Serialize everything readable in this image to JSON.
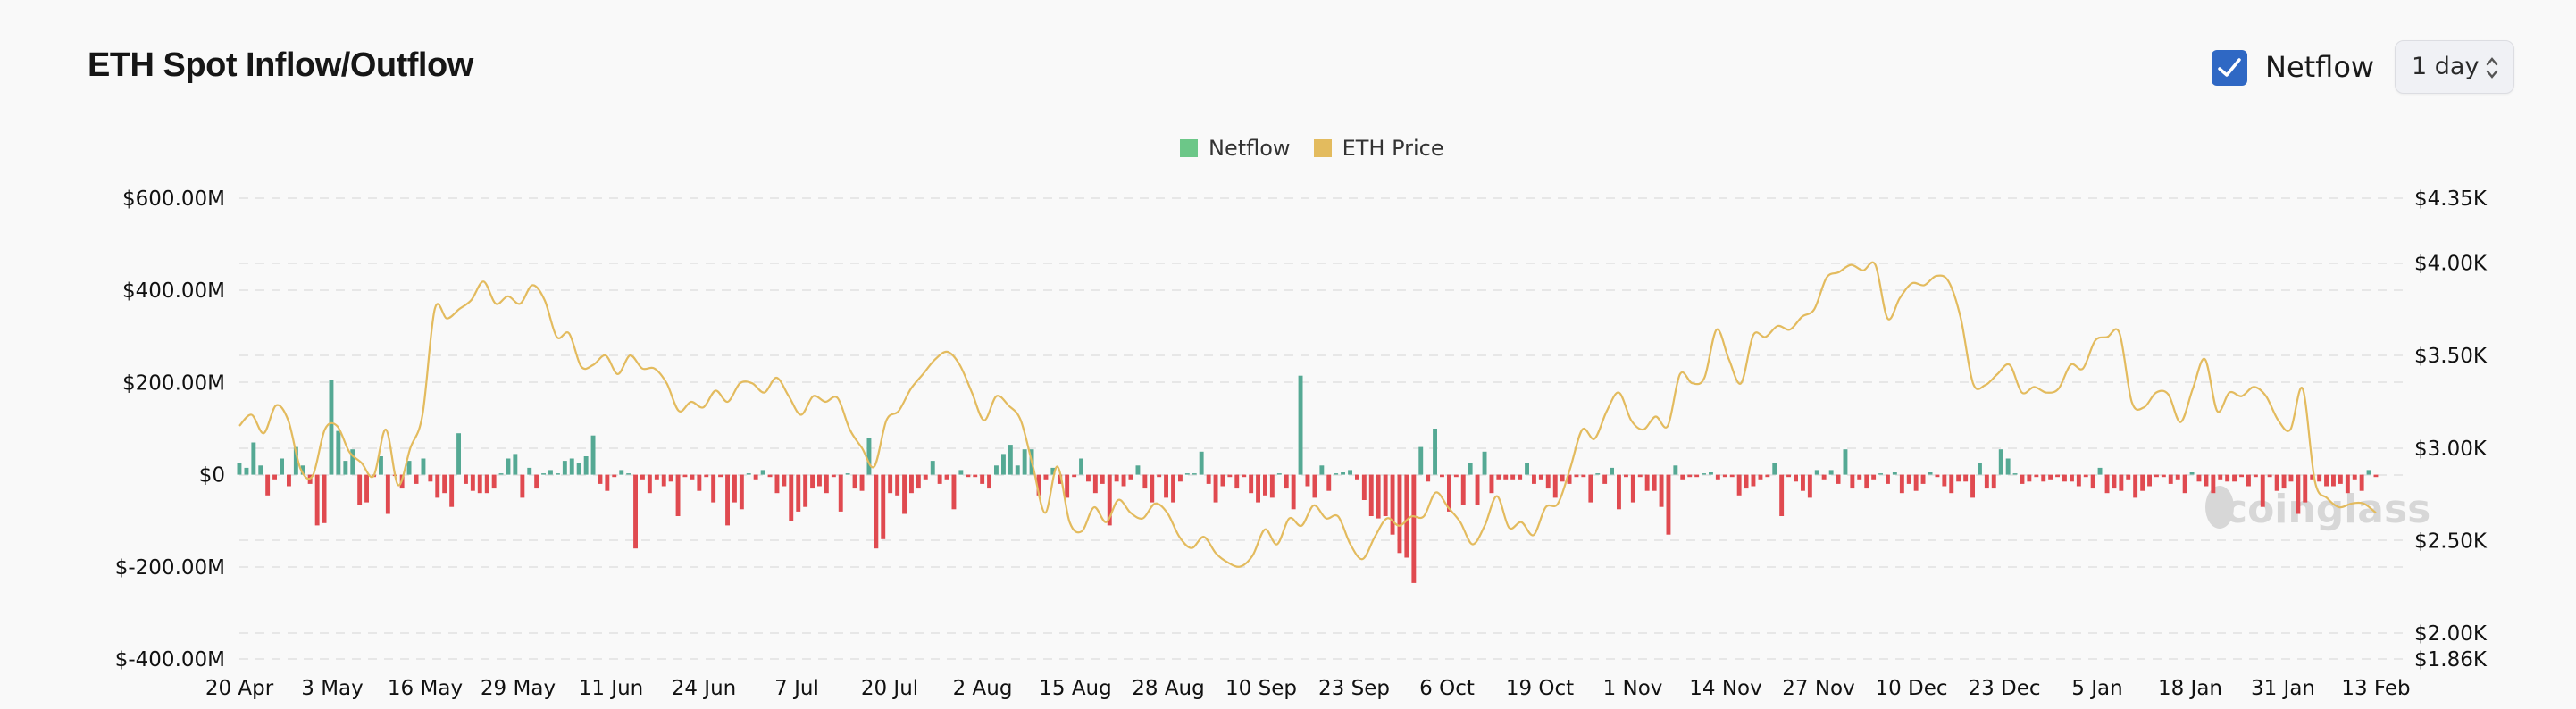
{
  "header": {
    "title": "ETH Spot Inflow/Outflow",
    "netflow_checkbox": {
      "label": "Netflow",
      "checked": true
    },
    "interval_select": {
      "value": "1 day"
    }
  },
  "legend": [
    {
      "label": "Netflow",
      "color": "#6cc788"
    },
    {
      "label": "ETH Price",
      "color": "#e3bb5e"
    }
  ],
  "watermark": "coinglass",
  "chart_data": {
    "type": "bar",
    "title": "ETH Spot Inflow/Outflow",
    "xlabel": "",
    "ylabel": "Netflow",
    "y2label": "ETH Price",
    "grid": true,
    "legend_position": "top-center",
    "x_tick_labels": [
      "20 Apr",
      "3 May",
      "16 May",
      "29 May",
      "11 Jun",
      "24 Jun",
      "7 Jul",
      "20 Jul",
      "2 Aug",
      "15 Aug",
      "28 Aug",
      "10 Sep",
      "23 Sep",
      "6 Oct",
      "19 Oct",
      "1 Nov",
      "14 Nov",
      "27 Nov",
      "10 Dec",
      "23 Dec",
      "5 Jan",
      "18 Jan",
      "31 Jan",
      "13 Feb"
    ],
    "y_left": {
      "ticks": [
        "$600.00M",
        "$400.00M",
        "$200.00M",
        "$0",
        "$-200.00M",
        "$-400.00M"
      ],
      "tick_values": [
        600,
        400,
        200,
        0,
        -200,
        -400
      ],
      "range": [
        -400,
        600
      ],
      "unit": "USD millions"
    },
    "y_right": {
      "ticks": [
        "$4.35K",
        "$4.00K",
        "$3.50K",
        "$3.00K",
        "$2.50K",
        "$2.00K",
        "$1.86K"
      ],
      "tick_values": [
        4350,
        4000,
        3500,
        3000,
        2500,
        2000,
        1860
      ],
      "range": [
        1860,
        4350
      ],
      "unit": "USD"
    },
    "positive_color": "#55a994",
    "negative_color": "#e04a50",
    "price_color": "#e3bb5e",
    "series": [
      {
        "name": "Netflow",
        "type": "bar",
        "start_date": "20 Apr",
        "interval": "1 day",
        "values": [
          25,
          15,
          70,
          20,
          -45,
          -10,
          35,
          -25,
          60,
          20,
          -20,
          -110,
          -105,
          205,
          95,
          30,
          55,
          -65,
          -60,
          -5,
          40,
          -85,
          -3,
          -30,
          30,
          -20,
          35,
          -15,
          -50,
          -40,
          -70,
          90,
          -20,
          -35,
          -40,
          -40,
          -30,
          0,
          35,
          45,
          -50,
          15,
          -30,
          0,
          10,
          0,
          30,
          35,
          25,
          40,
          85,
          -20,
          -35,
          -5,
          10,
          0,
          -160,
          -10,
          -40,
          -10,
          -25,
          -15,
          -90,
          -5,
          -10,
          -35,
          -5,
          -60,
          -5,
          -110,
          -60,
          -75,
          0,
          -10,
          10,
          -5,
          -40,
          -25,
          -100,
          -80,
          -70,
          -30,
          -25,
          -40,
          -5,
          -80,
          0,
          -30,
          -35,
          80,
          -160,
          -140,
          -40,
          -45,
          -85,
          -40,
          -30,
          -10,
          30,
          -20,
          -10,
          -75,
          10,
          -5,
          -5,
          -20,
          -30,
          20,
          45,
          65,
          20,
          55,
          55,
          -45,
          -10,
          15,
          -20,
          -50,
          -5,
          35,
          -15,
          -40,
          -20,
          -110,
          -15,
          -25,
          -10,
          20,
          -30,
          -60,
          -5,
          -50,
          -60,
          -15,
          0,
          0,
          50,
          -20,
          -60,
          -25,
          -5,
          -30,
          -5,
          -40,
          -60,
          -45,
          -50,
          0,
          -30,
          -75,
          215,
          -25,
          -50,
          20,
          -35,
          0,
          5,
          10,
          -10,
          -55,
          -90,
          -95,
          -90,
          -130,
          -170,
          -180,
          -235,
          60,
          -15,
          100,
          -5,
          -80,
          -5,
          -65,
          25,
          -65,
          50,
          -40,
          -10,
          -10,
          -10,
          -10,
          25,
          -20,
          -10,
          -30,
          -50,
          -15,
          -20,
          -5,
          -5,
          -60,
          0,
          -20,
          15,
          -75,
          -5,
          -60,
          -5,
          -35,
          -35,
          -70,
          -130,
          20,
          -10,
          -5,
          -5,
          0,
          5,
          -10,
          -5,
          -5,
          -45,
          -30,
          -25,
          -10,
          -5,
          25,
          -90,
          -5,
          -15,
          -35,
          -50,
          10,
          -10,
          10,
          -20,
          55,
          -30,
          -10,
          -30,
          -10,
          0,
          -20,
          5,
          -40,
          -20,
          -35,
          -20,
          5,
          -5,
          -25,
          -40,
          -15,
          -15,
          -50,
          25,
          -30,
          -30,
          55,
          35,
          0,
          -20,
          -15,
          -5,
          -15,
          -10,
          -5,
          -15,
          -15,
          -25,
          -5,
          -30,
          15,
          -40,
          -30,
          -35,
          -10,
          -50,
          -35,
          -25,
          -5,
          -5,
          -20,
          -10,
          -40,
          5,
          -15,
          -25,
          -40,
          -10,
          -15,
          -15,
          -5,
          -25,
          -5,
          -70,
          -5,
          -35,
          -30,
          -15,
          -85,
          -60,
          -10,
          -15,
          -25,
          -25,
          -20,
          -40,
          -10,
          -35,
          10,
          -5
        ],
        "note": "Bars per day (USD millions), read approximately from the chart"
      },
      {
        "name": "ETH Price",
        "type": "line",
        "sample_every_days": 4,
        "values": [
          3120,
          3180,
          3080,
          3230,
          3150,
          2890,
          2850,
          3100,
          3120,
          2980,
          2920,
          2850,
          3100,
          2800,
          3000,
          3180,
          3750,
          3700,
          3750,
          3800,
          3900,
          3780,
          3820,
          3780,
          3880,
          3800,
          3600,
          3620,
          3440,
          3450,
          3500,
          3400,
          3500,
          3430,
          3430,
          3350,
          3200,
          3250,
          3220,
          3310,
          3250,
          3350,
          3350,
          3300,
          3380,
          3280,
          3180,
          3280,
          3250,
          3270,
          3100,
          3000,
          2900,
          3150,
          3200,
          3320,
          3400,
          3480,
          3520,
          3450,
          3300,
          3150,
          3280,
          3230,
          3150,
          2900,
          2650,
          2900,
          2600,
          2550,
          2680,
          2600,
          2720,
          2650,
          2620,
          2700,
          2650,
          2520,
          2460,
          2520,
          2430,
          2380,
          2360,
          2420,
          2560,
          2480,
          2620,
          2580,
          2690,
          2620,
          2630,
          2480,
          2400,
          2520,
          2620,
          2580,
          2630,
          2630,
          2760,
          2680,
          2600,
          2480,
          2580,
          2740,
          2570,
          2600,
          2530,
          2680,
          2700,
          2890,
          3100,
          3050,
          3200,
          3300,
          3150,
          3100,
          3170,
          3120,
          3400,
          3350,
          3380,
          3640,
          3480,
          3350,
          3610,
          3600,
          3660,
          3640,
          3710,
          3750,
          3920,
          3950,
          3990,
          3960,
          3990,
          3700,
          3810,
          3890,
          3880,
          3930,
          3900,
          3700,
          3350,
          3340,
          3400,
          3450,
          3300,
          3330,
          3300,
          3320,
          3450,
          3430,
          3580,
          3600,
          3620,
          3250,
          3220,
          3300,
          3290,
          3140,
          3320,
          3480,
          3200,
          3300,
          3280,
          3330,
          3280,
          3150,
          3100,
          3320,
          2820,
          2730,
          2680,
          2700,
          2700,
          2650
        ]
      }
    ]
  }
}
